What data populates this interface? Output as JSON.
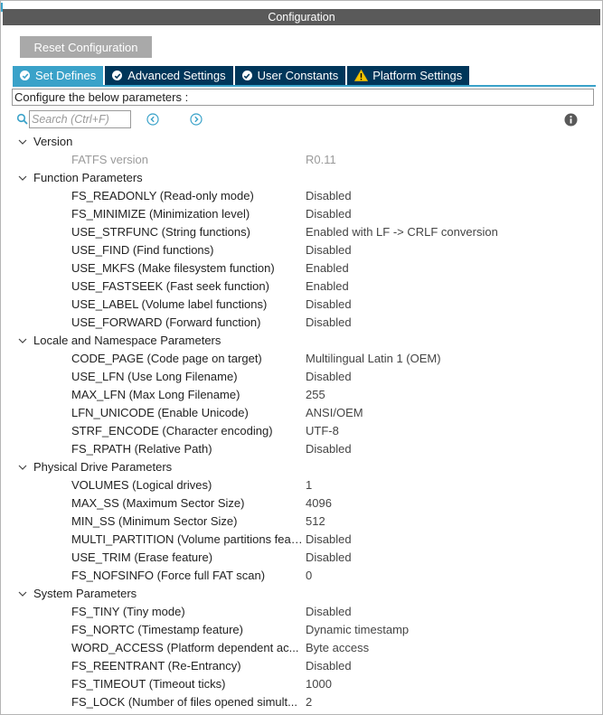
{
  "window": {
    "title": "Configuration"
  },
  "toolbar": {
    "reset_label": "Reset Configuration"
  },
  "tabs": [
    {
      "label": "Set Defines",
      "icon": "check-circle-icon",
      "active": true
    },
    {
      "label": "Advanced Settings",
      "icon": "check-circle-icon",
      "active": false
    },
    {
      "label": "User Constants",
      "icon": "check-circle-icon",
      "active": false
    },
    {
      "label": "Platform Settings",
      "icon": "warning-icon",
      "active": false
    }
  ],
  "info": {
    "text": "Configure the below parameters :"
  },
  "search": {
    "placeholder": "Search (Ctrl+F)",
    "value": ""
  },
  "colors": {
    "tab_active": "#3aa2c9",
    "tab_inactive": "#00365a",
    "titlebar": "#5a5a5a",
    "reset_button": "#a9a9a9",
    "warning": "#f2c500"
  },
  "groups": [
    {
      "label": "Version",
      "params": [
        {
          "name": "FATFS version",
          "value": "R0.11",
          "readonly": true
        }
      ]
    },
    {
      "label": "Function Parameters",
      "params": [
        {
          "name": "FS_READONLY (Read-only mode)",
          "value": "Disabled"
        },
        {
          "name": "FS_MINIMIZE (Minimization level)",
          "value": "Disabled"
        },
        {
          "name": "USE_STRFUNC (String functions)",
          "value": "Enabled with LF -> CRLF conversion"
        },
        {
          "name": "USE_FIND (Find functions)",
          "value": "Disabled"
        },
        {
          "name": "USE_MKFS (Make filesystem function)",
          "value": "Enabled"
        },
        {
          "name": "USE_FASTSEEK (Fast seek function)",
          "value": "Enabled"
        },
        {
          "name": "USE_LABEL (Volume label functions)",
          "value": "Disabled"
        },
        {
          "name": "USE_FORWARD (Forward function)",
          "value": "Disabled"
        }
      ]
    },
    {
      "label": "Locale and Namespace Parameters",
      "params": [
        {
          "name": "CODE_PAGE (Code page on target)",
          "value": "Multilingual Latin 1 (OEM)"
        },
        {
          "name": "USE_LFN (Use Long Filename)",
          "value": "Disabled"
        },
        {
          "name": "MAX_LFN (Max Long Filename)",
          "value": "255"
        },
        {
          "name": "LFN_UNICODE (Enable Unicode)",
          "value": "ANSI/OEM"
        },
        {
          "name": "STRF_ENCODE (Character encoding)",
          "value": "UTF-8"
        },
        {
          "name": "FS_RPATH (Relative Path)",
          "value": "Disabled"
        }
      ]
    },
    {
      "label": "Physical Drive Parameters",
      "params": [
        {
          "name": "VOLUMES (Logical drives)",
          "value": "1"
        },
        {
          "name": "MAX_SS (Maximum Sector Size)",
          "value": "4096"
        },
        {
          "name": "MIN_SS (Minimum Sector Size)",
          "value": "512"
        },
        {
          "name": "MULTI_PARTITION (Volume partitions feat...",
          "value": "Disabled"
        },
        {
          "name": "USE_TRIM (Erase feature)",
          "value": "Disabled"
        },
        {
          "name": "FS_NOFSINFO (Force full FAT scan)",
          "value": "0"
        }
      ]
    },
    {
      "label": "System Parameters",
      "params": [
        {
          "name": "FS_TINY (Tiny mode)",
          "value": "Disabled"
        },
        {
          "name": "FS_NORTC (Timestamp feature)",
          "value": "Dynamic timestamp"
        },
        {
          "name": "WORD_ACCESS (Platform dependent ac...",
          "value": "Byte access"
        },
        {
          "name": "FS_REENTRANT (Re-Entrancy)",
          "value": "Disabled"
        },
        {
          "name": "FS_TIMEOUT (Timeout ticks)",
          "value": "1000"
        },
        {
          "name": "FS_LOCK (Number of files opened simult...",
          "value": "2"
        }
      ]
    }
  ]
}
